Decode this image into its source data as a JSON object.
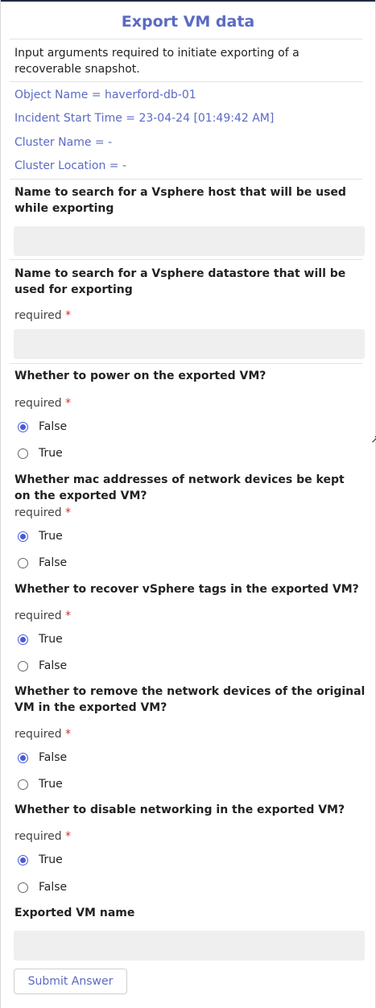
{
  "title": "Export VM data",
  "description": "Input arguments required to initiate exporting of a recoverable snapshot.",
  "info": {
    "object_name": "Object Name = haverford-db-01",
    "incident_start": "Incident Start Time = 23-04-24 [01:49:42 AM]",
    "cluster_name": "Cluster Name = -",
    "cluster_location": "Cluster Location = -"
  },
  "required_label": "required",
  "required_star": "*",
  "q_host": "Name to search for a Vsphere host that will be used while exporting",
  "q_datastore": "Name to search for a Vsphere datastore that will be used for exporting",
  "q_power": {
    "label": "Whether to power on the exported VM?",
    "options": [
      "False",
      "True"
    ]
  },
  "q_mac": {
    "label": "Whether mac addresses of network devices be kept on the exported VM?",
    "options": [
      "True",
      "False"
    ]
  },
  "q_tags": {
    "label": "Whether to recover vSphere tags in the exported VM?",
    "options": [
      "True",
      "False"
    ]
  },
  "q_remove_net": {
    "label": "Whether to remove the network devices of the original VM in the exported VM?",
    "options": [
      "False",
      "True"
    ]
  },
  "q_disable_net": {
    "label": "Whether to disable networking in the exported VM?",
    "options": [
      "True",
      "False"
    ]
  },
  "q_vmname": "Exported VM name",
  "submit": "Submit Answer",
  "colors": {
    "accent": "#5b6ac4",
    "radio": "#4a5ad8",
    "required_star": "#d03030",
    "input_bg": "#efefef"
  }
}
